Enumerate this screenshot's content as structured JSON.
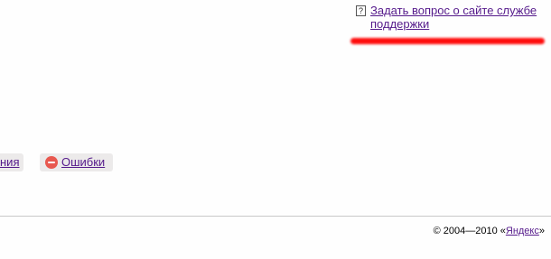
{
  "support": {
    "icon": "question-icon",
    "icon_glyph": "?",
    "link_text": "Задать вопрос о сайте службе поддержки",
    "link_color": "#551a8b"
  },
  "annotation": {
    "color": "#ff0000"
  },
  "tabs": [
    {
      "label": "ния"
    },
    {
      "label": "Ошибки",
      "icon": "error-icon"
    }
  ],
  "footer": {
    "copyright": "© 2004—2010 «",
    "brand_link": "Яндекс",
    "closing": "»"
  }
}
